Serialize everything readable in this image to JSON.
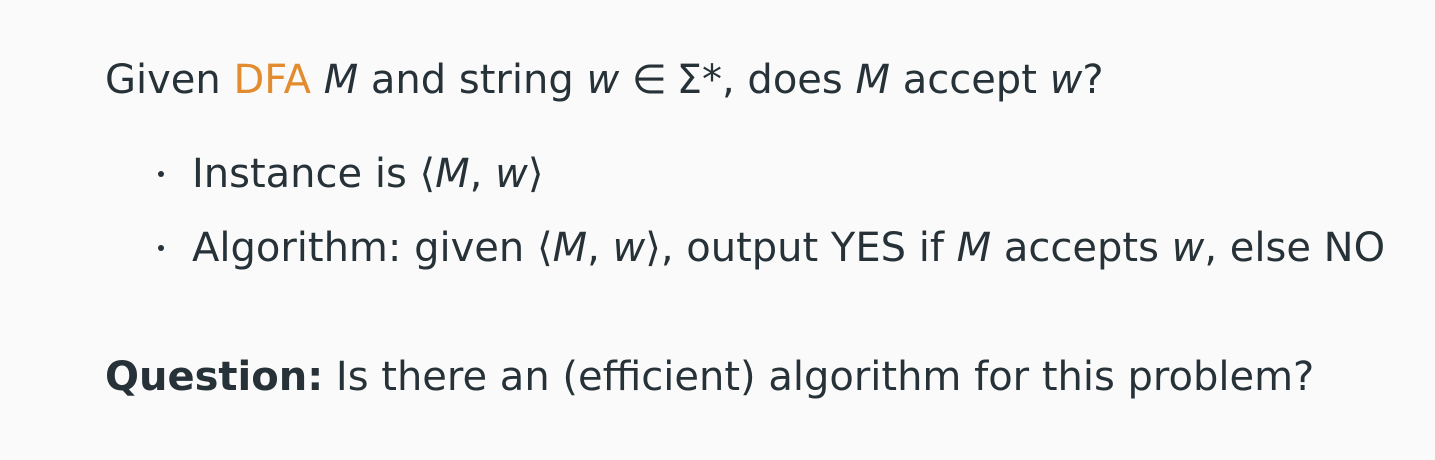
{
  "problem": {
    "given": "Given",
    "dfa": "DFA",
    "M": "M",
    "and_string": "and string",
    "w": "w",
    "in": "∈",
    "sigma_star": "Σ*",
    "comma_does": ", does",
    "accept": "accept",
    "qmark": "?"
  },
  "bullets": [
    {
      "prefix": "Instance is",
      "langle": "⟨",
      "M": "M",
      "sep": ",",
      "w": "w",
      "rangle": "⟩"
    },
    {
      "prefix": "Algorithm: given",
      "langle": "⟨",
      "M": "M",
      "sep": ",",
      "w": "w",
      "rangle": "⟩",
      "mid": ", output YES if",
      "accepts": "accepts",
      "tail": ", else NO"
    }
  ],
  "question": {
    "label": "Question:",
    "text": "Is there an (efficient) algorithm for this problem?"
  },
  "colors": {
    "accent": "#e38b2f",
    "text": "#263238",
    "background": "#fafafa"
  }
}
